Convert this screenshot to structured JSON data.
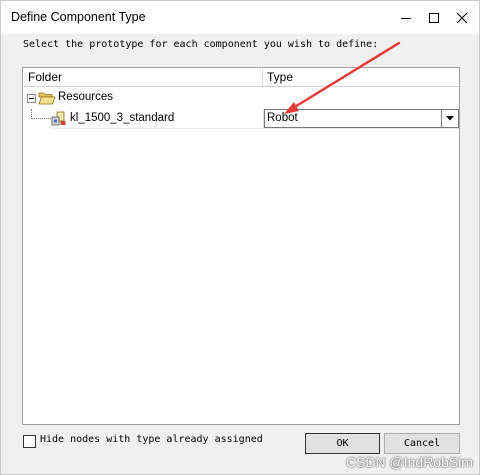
{
  "window": {
    "title": "Define Component Type"
  },
  "prompt": "Select the prototype for each component you wish to define:",
  "columns": {
    "folder": "Folder",
    "type": "Type"
  },
  "tree": {
    "root_label": "Resources",
    "component_label": "kl_1500_3_standard",
    "component_type": "Robot"
  },
  "checkbox": {
    "label": "Hide nodes with type already assigned",
    "checked": false
  },
  "buttons": {
    "ok": "OK",
    "cancel": "Cancel"
  },
  "watermark": "CSDN @IndRobSim",
  "colors": {
    "annotation_arrow": "#e53935"
  },
  "icons": {
    "minimize": "minimize-icon",
    "maximize": "maximize-icon",
    "close": "close-icon",
    "folder": "folder-open-icon",
    "component": "component-icon",
    "dropdown": "chevron-down-icon"
  }
}
